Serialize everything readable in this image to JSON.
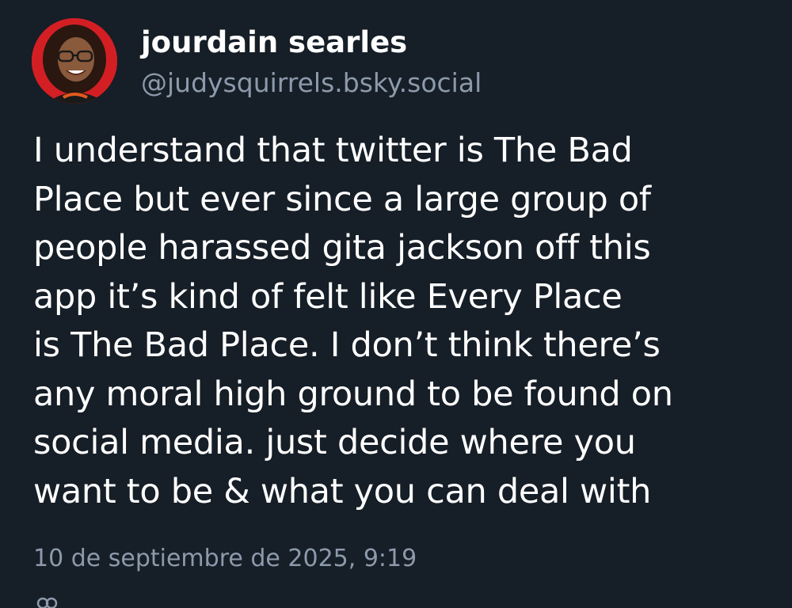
{
  "post": {
    "author": {
      "display_name": "jourdain searles",
      "handle": "@judysquirrels.bsky.social"
    },
    "text_lines": [
      "I understand that twitter is The Bad",
      "Place but ever since a large group of",
      "people harassed gita jackson off this",
      "app it’s kind of felt like Every Place",
      "is The Bad Place. I don’t think there’s",
      "any moral high ground to be found on",
      "social media. just decide where you",
      "want to be & what you can deal with"
    ],
    "timestamp": "10 de septiembre de 2025, 9:19",
    "footer": {
      "audience_icon": "people-icon",
      "audience_text": "",
      "translate_label": ""
    }
  },
  "colors": {
    "background": "#161e27",
    "text_primary": "#ffffff",
    "text_secondary": "#8c9aab",
    "link": "#208bfe",
    "avatar_bg": "#d31f24"
  }
}
